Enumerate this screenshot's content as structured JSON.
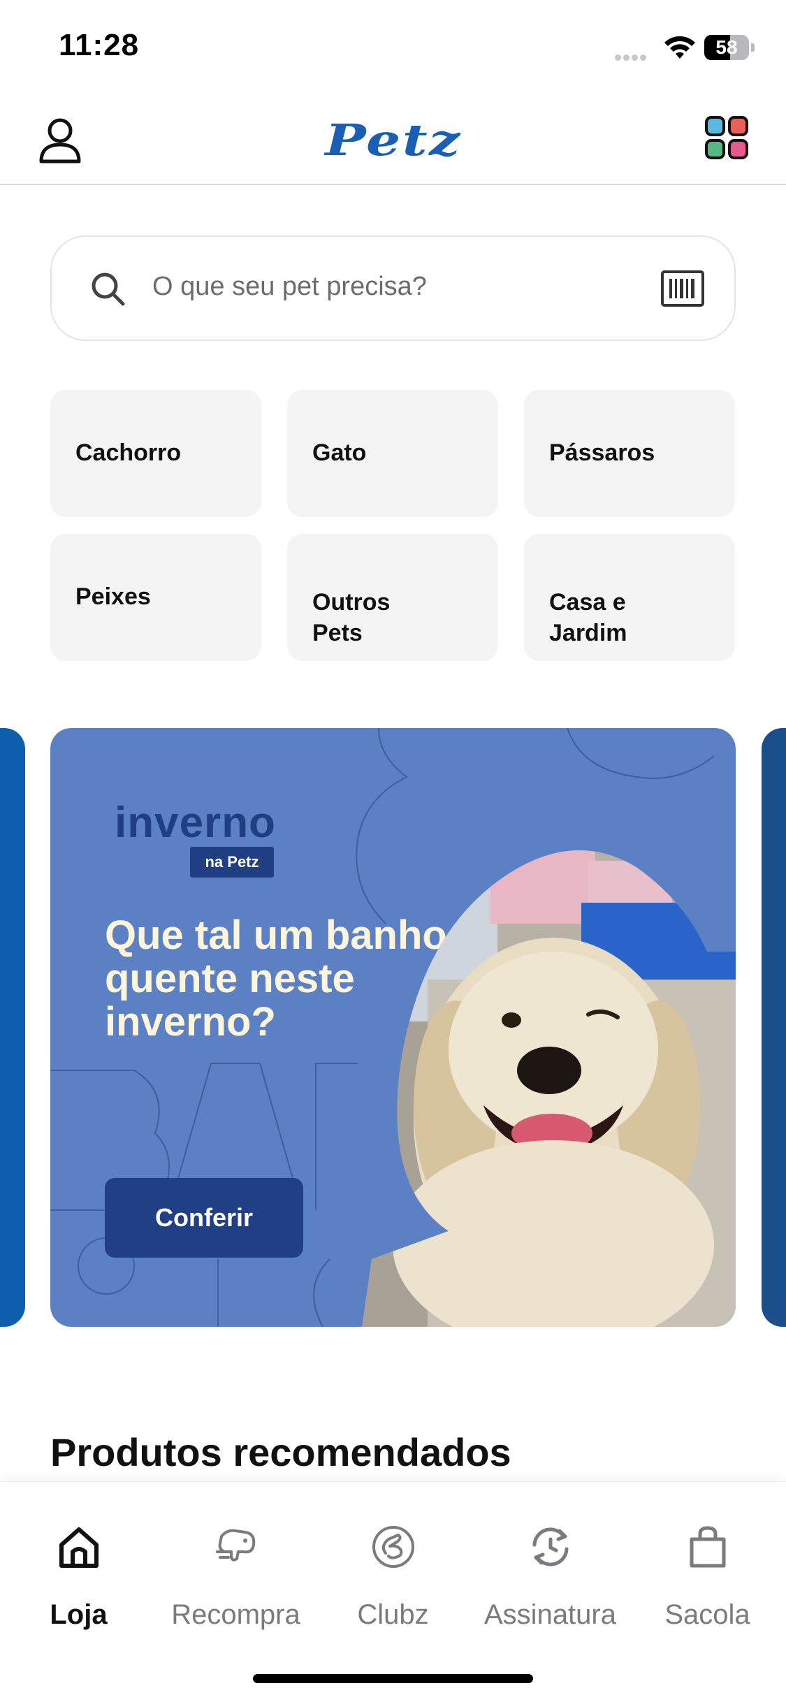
{
  "status_bar": {
    "time": "11:28",
    "battery_level": "58",
    "icons": [
      "cellular-signal-icon",
      "wifi-icon",
      "battery-icon"
    ]
  },
  "header": {
    "logo_text": "Petz",
    "icons": [
      "profile-icon",
      "apps-grid-icon"
    ],
    "brand_color": "#1a5fb4"
  },
  "search": {
    "placeholder": "O que seu pet precisa?",
    "icons": [
      "search-icon",
      "barcode-scanner-icon"
    ]
  },
  "categories": [
    {
      "label": "Cachorro"
    },
    {
      "label": "Gato"
    },
    {
      "label": "Pássaros"
    },
    {
      "label": "Peixes"
    },
    {
      "label": "Outros\nPets"
    },
    {
      "label": "Casa e\nJardim"
    }
  ],
  "banner": {
    "brand": "inverno",
    "tag": "na Petz",
    "title": "Que tal um banho quente neste inverno?",
    "cta_label": "Conferir",
    "background_color": "#5b80c3",
    "cta_color": "#213f85"
  },
  "recommended": {
    "title": "Produtos recomendados"
  },
  "bottom_nav": {
    "items": [
      {
        "label": "Loja",
        "icon": "home-icon",
        "active": true
      },
      {
        "label": "Recompra",
        "icon": "repurchase-icon",
        "active": false
      },
      {
        "label": "Clubz",
        "icon": "clubz-icon",
        "active": false
      },
      {
        "label": "Assinatura",
        "icon": "subscription-icon",
        "active": false
      },
      {
        "label": "Sacola",
        "icon": "shopping-bag-icon",
        "active": false
      }
    ]
  }
}
